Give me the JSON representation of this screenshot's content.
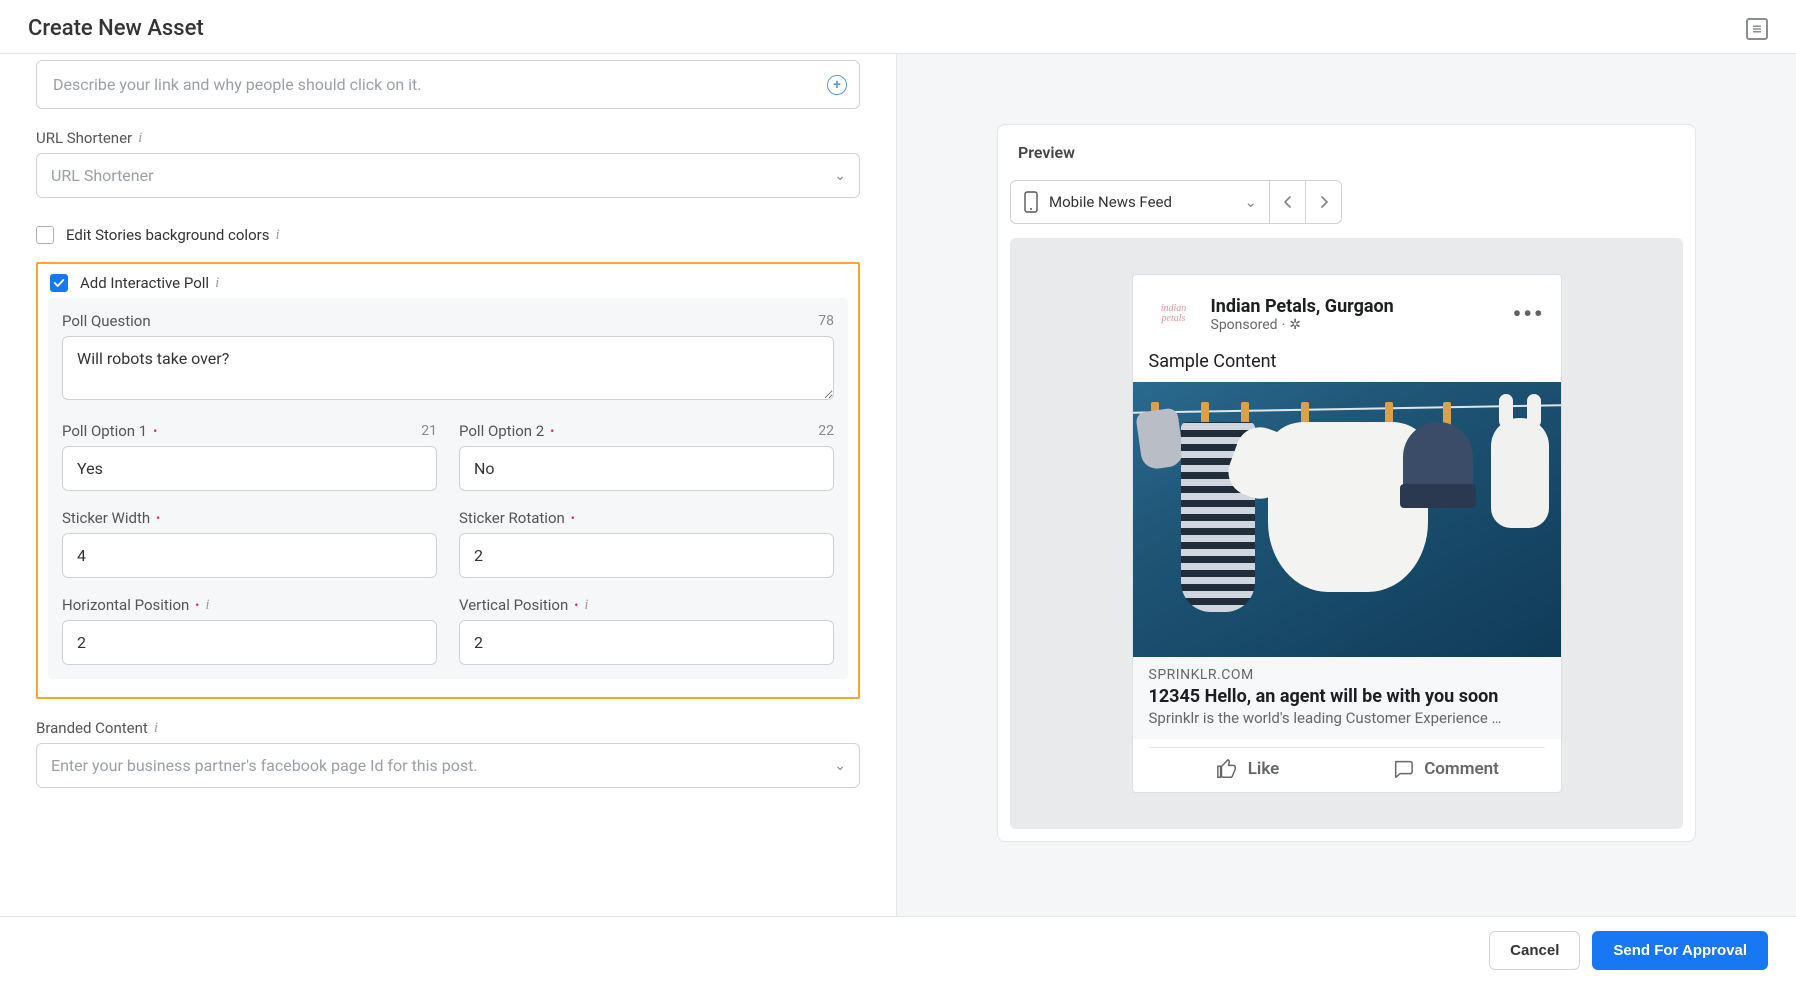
{
  "header": {
    "title": "Create New Asset"
  },
  "form": {
    "describe_placeholder": "Describe your link and why people should click on it.",
    "url_shortener": {
      "label": "URL Shortener",
      "placeholder": "URL Shortener"
    },
    "edit_stories": {
      "label": "Edit Stories background colors",
      "checked": false
    },
    "poll": {
      "title": "Add Interactive Poll",
      "checked": true,
      "question": {
        "label": "Poll Question",
        "value": "Will robots take over?",
        "counter": "78"
      },
      "option1": {
        "label": "Poll Option 1",
        "value": "Yes",
        "counter": "21"
      },
      "option2": {
        "label": "Poll Option 2",
        "value": "No",
        "counter": "22"
      },
      "width": {
        "label": "Sticker Width",
        "value": "4"
      },
      "rotation": {
        "label": "Sticker Rotation",
        "value": "2"
      },
      "hpos": {
        "label": "Horizontal Position",
        "value": "2"
      },
      "vpos": {
        "label": "Vertical Position",
        "value": "2"
      }
    },
    "branded": {
      "label": "Branded Content",
      "placeholder": "Enter your business partner's facebook page Id for this post."
    }
  },
  "preview": {
    "title": "Preview",
    "feed_selector": "Mobile News Feed",
    "card": {
      "page_name": "Indian Petals, Gurgaon",
      "sponsored": "Sponsored",
      "body": "Sample Content",
      "domain": "SPRINKLR.COM",
      "headline": "12345 Hello, an agent will be with you soon",
      "description": "Sprinklr is the world's leading Customer Experience …",
      "like": "Like",
      "comment": "Comment"
    }
  },
  "footer": {
    "cancel": "Cancel",
    "send": "Send For Approval"
  }
}
